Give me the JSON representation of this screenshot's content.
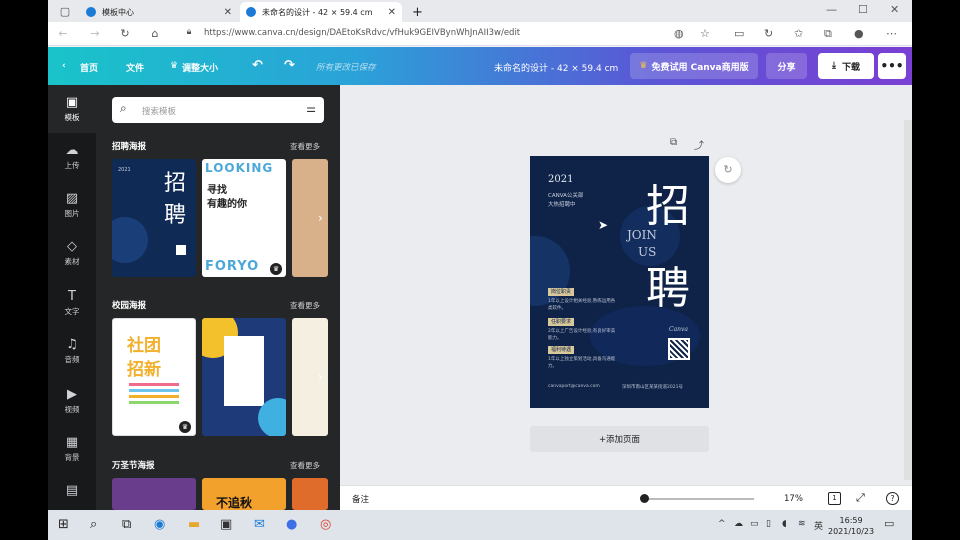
{
  "browser": {
    "tabs": [
      {
        "title": "模板中心"
      },
      {
        "title": "未命名的设计 - 42 × 59.4 cm"
      }
    ],
    "new_tab": "+",
    "url": "https://www.canva.cn/design/DAEtoKsRdvc/vfHuk9GEIVBynWhJnAII3w/edit",
    "controls": {
      "minimize": "—",
      "maximize": "☐",
      "close": "✕"
    }
  },
  "canva_topbar": {
    "home": "首页",
    "file": "文件",
    "resize": "调整大小",
    "saved_status": "所有更改已保存",
    "design_title": "未命名的设计 - 42 × 59.4 cm",
    "try_canva": "免费试用 Canva商用版",
    "share": "分享",
    "download": "下载",
    "more": "•••"
  },
  "left_nav": [
    {
      "label": "模板",
      "icon": "template-icon",
      "glyph": "▣"
    },
    {
      "label": "上传",
      "icon": "upload-icon",
      "glyph": "☁"
    },
    {
      "label": "图片",
      "icon": "image-icon",
      "glyph": "▨"
    },
    {
      "label": "素材",
      "icon": "elements-icon",
      "glyph": "◇"
    },
    {
      "label": "文字",
      "icon": "text-icon",
      "glyph": "T"
    },
    {
      "label": "音频",
      "icon": "audio-icon",
      "glyph": "♫"
    },
    {
      "label": "视频",
      "icon": "video-icon",
      "glyph": "▶"
    },
    {
      "label": "背景",
      "icon": "background-icon",
      "glyph": "▦"
    },
    {
      "label": "",
      "icon": "more-apps-icon",
      "glyph": "▤"
    }
  ],
  "panel": {
    "search_placeholder": "搜索模板",
    "sections": [
      {
        "title": "招聘海报",
        "more": "查看更多"
      },
      {
        "title": "校园海报",
        "more": "查看更多"
      },
      {
        "title": "万圣节海报",
        "more": "查看更多"
      }
    ],
    "thumb_texts": {
      "recruit_zhao": "招",
      "recruit_pin": "聘",
      "recruit_year": "2021",
      "looking": "LOOKING",
      "looking_line1": "寻找",
      "looking_line2": "有趣的你",
      "foryou": "FORYO",
      "club_line1": "社团",
      "club_line2": "招新",
      "halloween": "不追秋"
    }
  },
  "poster": {
    "year": "2021",
    "sub1": "CANVA公关部",
    "sub2": "大热招聘中",
    "zhao": "招",
    "pin": "聘",
    "join": "JOIN",
    "us": "US",
    "labels": [
      "岗位职责",
      "任职要求",
      "福利待遇"
    ],
    "body_lines": [
      "1年以上设计相关经验,熟练运用各类软件。",
      "2年以上广告设计经验,有良好审美能力。",
      "1年以上独立策划活动,具备沟通能力。"
    ],
    "signature": "Canva",
    "email": "canvaport@canva.com",
    "address": "深圳市南山区某某街道2021号"
  },
  "canvas": {
    "add_page": "+添加页面"
  },
  "bottombar": {
    "notes": "备注",
    "zoom": "17%",
    "page": "1"
  },
  "taskbar": {
    "time": "16:59",
    "date": "2021/10/23",
    "lang": "英"
  }
}
